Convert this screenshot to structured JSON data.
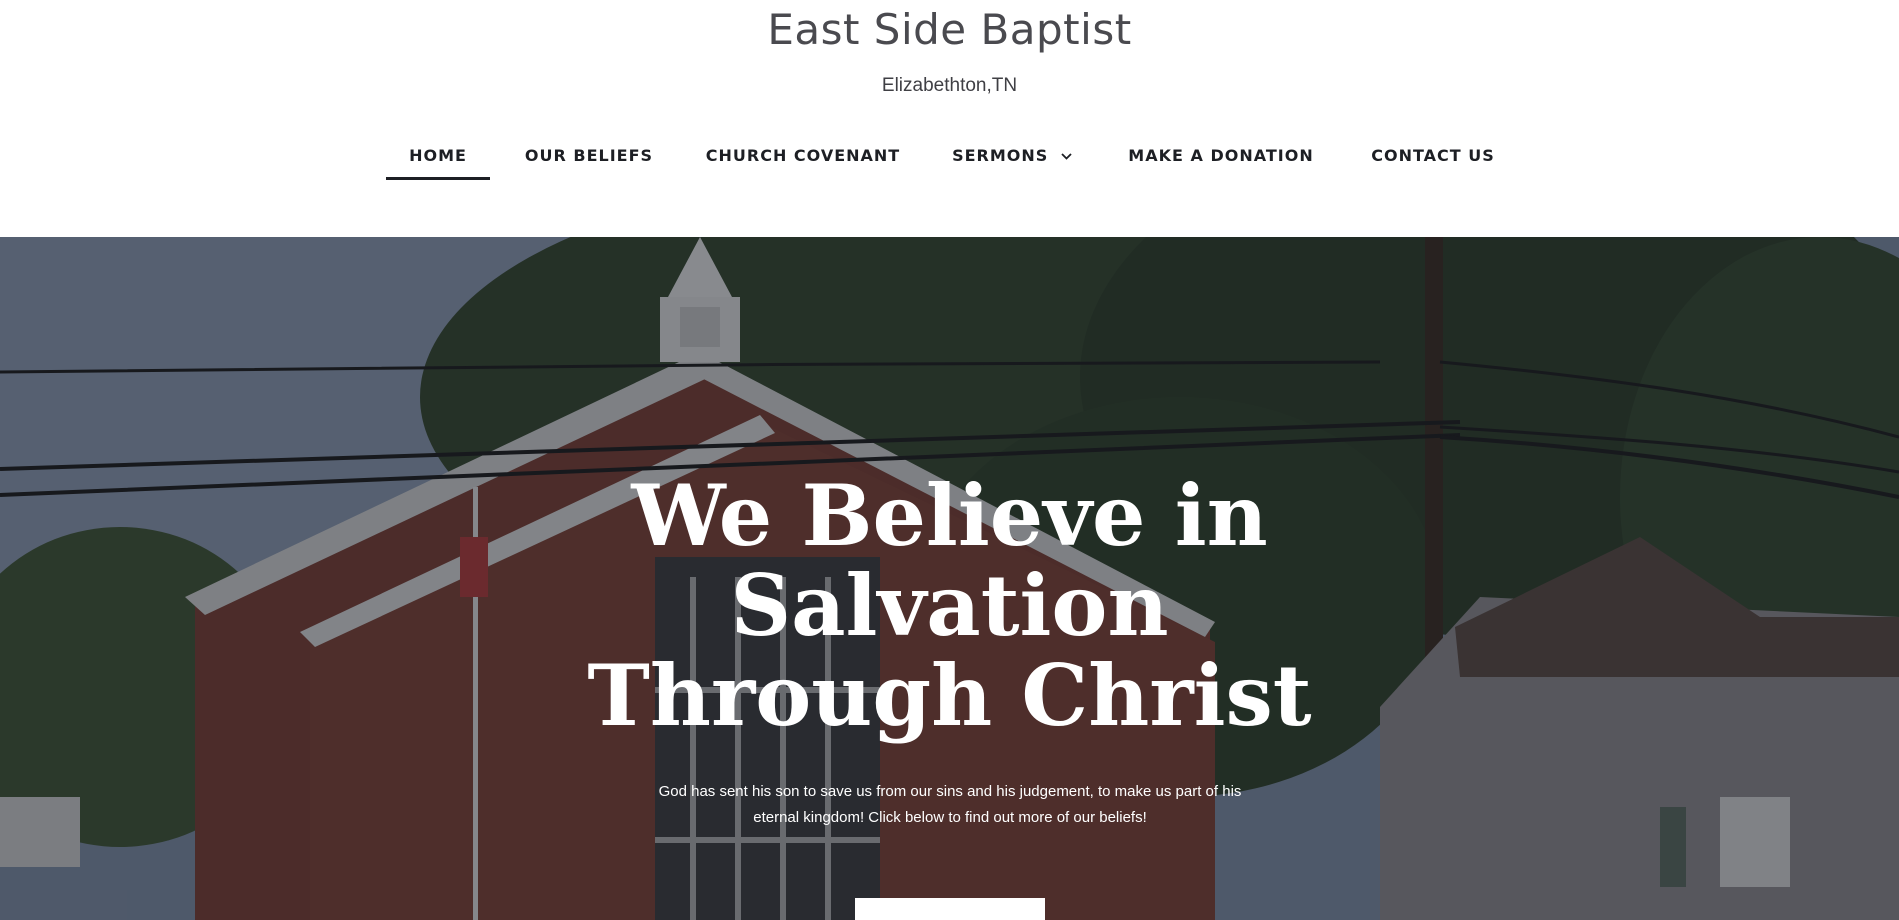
{
  "header": {
    "site_title": "East Side Baptist",
    "tagline": "Elizabethton,TN"
  },
  "nav": {
    "items": [
      {
        "label": "HOME",
        "active": true
      },
      {
        "label": "OUR BELIEFS"
      },
      {
        "label": "CHURCH COVENANT"
      },
      {
        "label": "SERMONS",
        "has_dropdown": true,
        "icon": "chevron-down-icon"
      },
      {
        "label": "MAKE A DONATION"
      },
      {
        "label": "CONTACT US"
      }
    ]
  },
  "hero": {
    "heading_lines": [
      "We Believe in",
      "Salvation",
      "Through Christ"
    ],
    "text": "God has sent his son to save us from our sins and his judgement, to make us part of his eternal kingdom! Click below to find out more of our beliefs!",
    "button_label": ""
  },
  "colors": {
    "nav_text": "#1d1f24",
    "title_text": "#4a4a4f",
    "hero_text": "#ffffff",
    "button_bg": "#ffffff"
  }
}
